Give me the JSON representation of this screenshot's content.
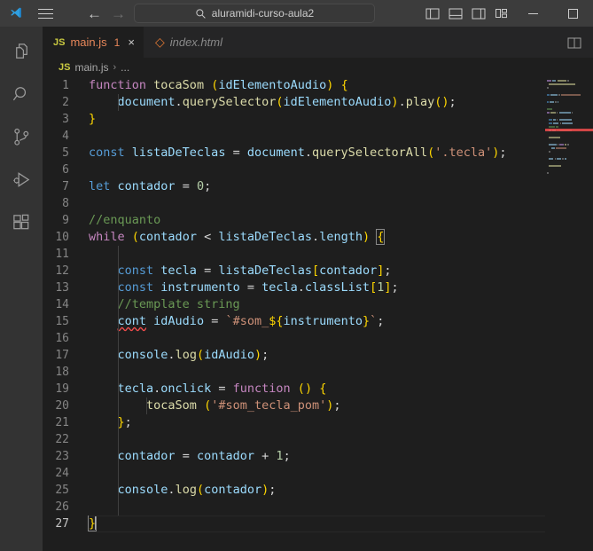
{
  "titlebar": {
    "logo_icon": "vscode-logo-icon",
    "menu_icon": "hamburger-menu-icon",
    "back_icon": "arrow-back-icon",
    "forward_icon": "arrow-forward-icon",
    "search": {
      "icon": "search-icon",
      "value": "aluramidi-curso-aula2",
      "placeholder": "Search"
    },
    "layout_buttons": [
      {
        "name": "toggle-primary-sidebar-icon",
        "label": "Toggle Primary Side Bar"
      },
      {
        "name": "toggle-panel-icon",
        "label": "Toggle Panel"
      },
      {
        "name": "toggle-secondary-sidebar-icon",
        "label": "Toggle Secondary Side Bar"
      },
      {
        "name": "customize-layout-icon",
        "label": "Customize Layout"
      }
    ],
    "window_controls": [
      {
        "name": "minimize-button",
        "glyph": "─"
      },
      {
        "name": "maximize-button",
        "glyph": "□"
      }
    ]
  },
  "activitybar": {
    "items": [
      {
        "name": "sidebar-item-explorer",
        "label": "Explorer",
        "icon": "files-icon"
      },
      {
        "name": "sidebar-item-search",
        "label": "Search",
        "icon": "search-icon"
      },
      {
        "name": "sidebar-item-source-control",
        "label": "Source Control",
        "icon": "source-control-icon"
      },
      {
        "name": "sidebar-item-run-debug",
        "label": "Run and Debug",
        "icon": "run-debug-icon"
      },
      {
        "name": "sidebar-item-extensions",
        "label": "Extensions",
        "icon": "extensions-icon"
      }
    ]
  },
  "tabs": [
    {
      "name": "tab-main-js",
      "label": "main.js",
      "icon": "js-file-icon",
      "icon_text": "JS",
      "badge": "1",
      "close": "×",
      "active": true,
      "italic": false
    },
    {
      "name": "tab-index-html",
      "label": "index.html",
      "icon": "html-file-icon",
      "icon_text": "◇",
      "badge": "",
      "close": "",
      "active": false,
      "italic": true
    }
  ],
  "tabs_actions": [
    {
      "name": "split-editor-right-button",
      "label": "Split Editor Right"
    }
  ],
  "breadcrumb": {
    "file_icon_text": "JS",
    "file": "main.js",
    "separator": "›",
    "tail": "..."
  },
  "editor": {
    "language": "javascript",
    "active_line": 27,
    "total_lines": 27,
    "lines": [
      {
        "n": "1",
        "text": "function tocaSom (idElementoAudio) {"
      },
      {
        "n": "2",
        "text": "    document.querySelector(idElementoAudio).play();"
      },
      {
        "n": "3",
        "text": "}"
      },
      {
        "n": "4",
        "text": ""
      },
      {
        "n": "5",
        "text": "const listaDeTeclas = document.querySelectorAll('.tecla');"
      },
      {
        "n": "6",
        "text": ""
      },
      {
        "n": "7",
        "text": "let contador = 0;"
      },
      {
        "n": "8",
        "text": ""
      },
      {
        "n": "9",
        "text": "//enquanto"
      },
      {
        "n": "10",
        "text": "while (contador < listaDeTeclas.length) {"
      },
      {
        "n": "11",
        "text": ""
      },
      {
        "n": "12",
        "text": "    const tecla = listaDeTeclas[contador];"
      },
      {
        "n": "13",
        "text": "    const instrumento = tecla.classList[1];"
      },
      {
        "n": "14",
        "text": "    //template string"
      },
      {
        "n": "15",
        "text": "    cont idAudio = `#som_${instrumento}`;"
      },
      {
        "n": "16",
        "text": ""
      },
      {
        "n": "17",
        "text": "    console.log(idAudio);"
      },
      {
        "n": "18",
        "text": ""
      },
      {
        "n": "19",
        "text": "    tecla.onclick = function () {"
      },
      {
        "n": "20",
        "text": "        tocaSom ('#som_tecla_pom');"
      },
      {
        "n": "21",
        "text": "    };"
      },
      {
        "n": "22",
        "text": ""
      },
      {
        "n": "23",
        "text": "    contador = contador + 1;"
      },
      {
        "n": "24",
        "text": ""
      },
      {
        "n": "25",
        "text": "    console.log(contador);"
      },
      {
        "n": "26",
        "text": ""
      },
      {
        "n": "27",
        "text": "}"
      }
    ]
  },
  "minimap": {
    "name": "minimap",
    "error_line": 15
  },
  "colors": {
    "editor_bg": "#1e1e1e",
    "titlebar_bg": "#3c3c3c",
    "tabbar_bg": "#252526",
    "activitybar_bg": "#333333",
    "accent_error": "#f14c4c",
    "tab_active_fg": "#e8875a",
    "keyword": "#c586c0",
    "declaration": "#569cd6",
    "variable": "#9cdcfe",
    "function": "#dcdcaa",
    "string": "#ce9178",
    "number": "#b5cea8",
    "comment": "#6a9955",
    "bracket_yellow": "#ffd700",
    "bracket_magenta": "#da70d6",
    "bracket_blue": "#179fff"
  }
}
